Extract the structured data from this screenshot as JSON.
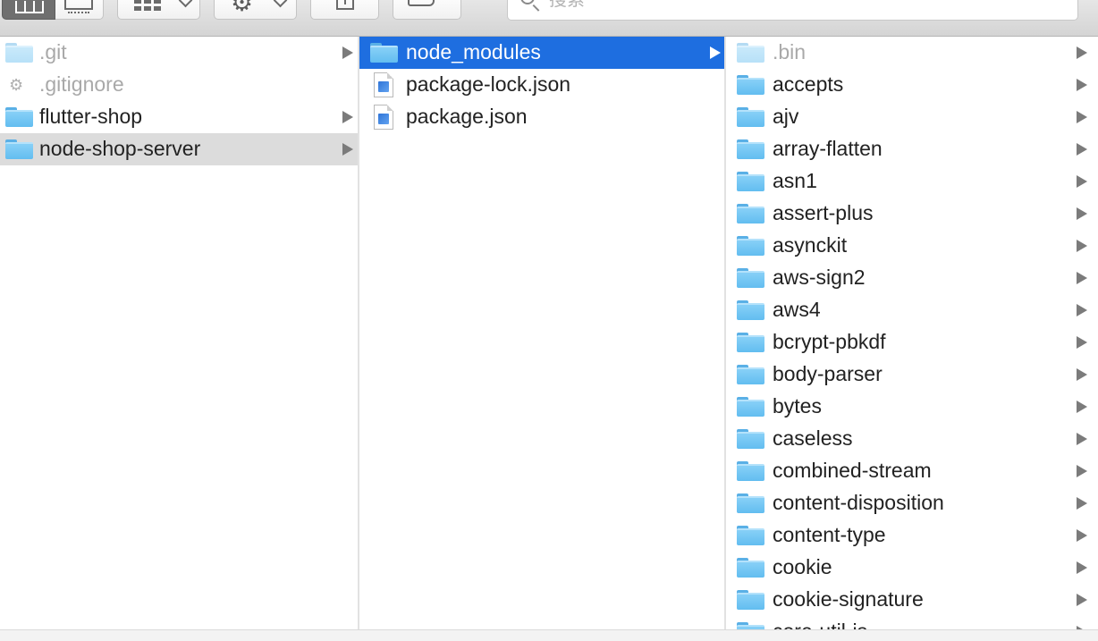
{
  "toolbar": {
    "search_placeholder": "搜索",
    "view_mode": "columns",
    "icons": [
      "columns-view-icon",
      "cover-flow-view-icon",
      "group-grid-icon",
      "action-gear-icon",
      "share-icon",
      "tag-icon",
      "search-icon"
    ]
  },
  "column1": {
    "items": [
      {
        "name": ".git",
        "kind": "folder",
        "dim": true,
        "has_children": true
      },
      {
        "name": ".gitignore",
        "kind": "file",
        "dim": true,
        "has_children": false
      },
      {
        "name": "flutter-shop",
        "kind": "folder",
        "dim": false,
        "has_children": true
      },
      {
        "name": "node-shop-server",
        "kind": "folder",
        "dim": false,
        "has_children": true,
        "selected": true
      }
    ]
  },
  "column2": {
    "items": [
      {
        "name": "node_modules",
        "kind": "folder",
        "has_children": true,
        "selected": true
      },
      {
        "name": "package-lock.json",
        "kind": "json-file",
        "has_children": false
      },
      {
        "name": "package.json",
        "kind": "json-file",
        "has_children": false
      }
    ]
  },
  "column3": {
    "items": [
      {
        "name": ".bin",
        "dim": true
      },
      {
        "name": "accepts"
      },
      {
        "name": "ajv"
      },
      {
        "name": "array-flatten"
      },
      {
        "name": "asn1"
      },
      {
        "name": "assert-plus"
      },
      {
        "name": "asynckit"
      },
      {
        "name": "aws-sign2"
      },
      {
        "name": "aws4"
      },
      {
        "name": "bcrypt-pbkdf"
      },
      {
        "name": "body-parser"
      },
      {
        "name": "bytes"
      },
      {
        "name": "caseless"
      },
      {
        "name": "combined-stream"
      },
      {
        "name": "content-disposition"
      },
      {
        "name": "content-type"
      },
      {
        "name": "cookie"
      },
      {
        "name": "cookie-signature"
      },
      {
        "name": "core-util-is"
      }
    ]
  },
  "colors": {
    "selection_active": "#1e6ee0",
    "selection_inactive": "#dcdcdc",
    "folder": "#6ec3f3"
  }
}
